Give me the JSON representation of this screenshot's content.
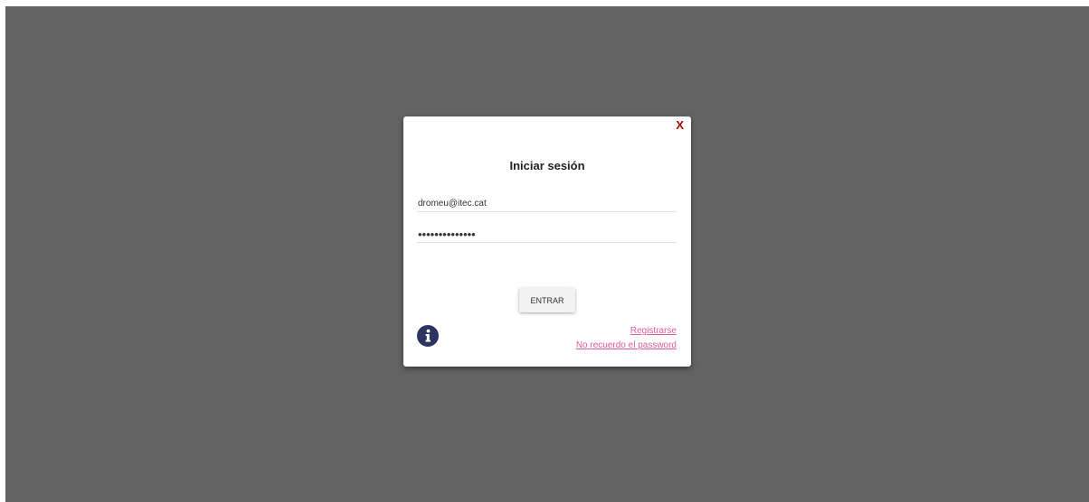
{
  "dialog": {
    "close_label": "X",
    "title": "Iniciar sesión",
    "email_value": "dromeu@itec.cat",
    "password_value": "••••••••••••••",
    "enter_label": "ENTRAR",
    "register_label": "Registrarse",
    "forgot_label": "No recuerdo el password"
  },
  "icons": {
    "info": "info-icon",
    "close": "close-icon"
  },
  "colors": {
    "backdrop": "#636363",
    "close": "#b00000",
    "link": "#e05a9e",
    "info_icon": "#2b3560"
  }
}
